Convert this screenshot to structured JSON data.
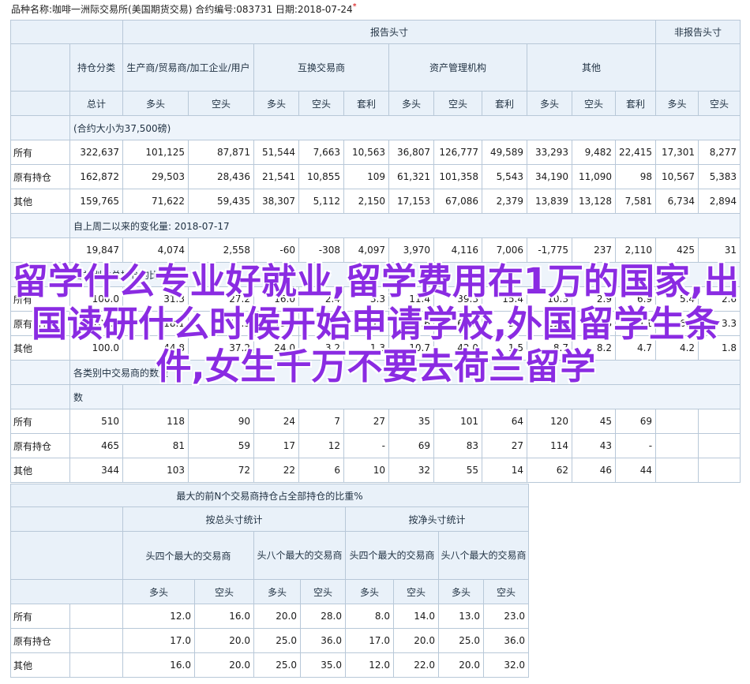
{
  "header": {
    "text": "品种名称:咖啡一洲际交易所(美国期货交易)   合约编号:083731   日期:2018-07-24",
    "mark": "*"
  },
  "table1": {
    "reportable": "报告头寸",
    "nonreportable": "非报告头寸",
    "holding_category": "持仓分类",
    "producers": "生产商/贸易商/加工企业/用户",
    "swap": "互换交易商",
    "managed": "资产管理机构",
    "other": "其他",
    "total": "总计",
    "long": "多头",
    "short": "空头",
    "spread": "套利",
    "note1": "(合约大小为37,500磅)",
    "note2": "自上周二以来的变化量: 2018-07-17",
    "note3": "各类别占总持仓的比例",
    "note4a": "各类别中交易商的数量",
    "note4b": "数",
    "rows_positions": [
      {
        "label": "所有",
        "values": [
          "322,637",
          "101,125",
          "87,871",
          "51,544",
          "7,663",
          "10,563",
          "36,807",
          "126,777",
          "49,589",
          "33,293",
          "9,482",
          "22,415",
          "17,301",
          "8,277"
        ]
      },
      {
        "label": "原有持仓",
        "values": [
          "162,872",
          "29,503",
          "28,436",
          "21,541",
          "10,855",
          "109",
          "61,321",
          "101,358",
          "5,543",
          "34,190",
          "11,090",
          "98",
          "10,567",
          "5,383"
        ]
      },
      {
        "label": "其他",
        "values": [
          "159,765",
          "71,622",
          "59,435",
          "38,307",
          "5,112",
          "2,150",
          "17,153",
          "67,086",
          "2,379",
          "13,839",
          "13,128",
          "7,581",
          "6,734",
          "2,894"
        ]
      }
    ],
    "row_changes": [
      "19,847",
      "4,074",
      "2,558",
      "-60",
      "-308",
      "4,097",
      "3,970",
      "4,116",
      "7,006",
      "-1,775",
      "237",
      "2,110",
      "425",
      "31"
    ],
    "rows_percent": [
      {
        "label": "所有",
        "values": [
          "100.0",
          "31.3",
          "27.2",
          "16.0",
          "2.4",
          "3.3",
          "11.4",
          "39.3",
          "15.4",
          "10.3",
          "2.9",
          "6.9",
          "5.4",
          "2.6"
        ]
      },
      {
        "label": "原有持仓",
        "values": [
          "100.0",
          "18.1",
          "17.5",
          "13.2",
          "6.7",
          "0.1",
          "37.6",
          "62.2",
          "3.4",
          "21.0",
          "6.8",
          "0.1",
          "6.5",
          "3.3"
        ]
      },
      {
        "label": "其他",
        "values": [
          "100.0",
          "44.8",
          "37.2",
          "24.0",
          "3.2",
          "1.3",
          "10.7",
          "42.0",
          "1.5",
          "8.7",
          "8.2",
          "4.7",
          "4.2",
          "1.8"
        ]
      }
    ],
    "rows_traders": [
      {
        "label": "所有",
        "values": [
          "510",
          "118",
          "90",
          "24",
          "7",
          "27",
          "35",
          "101",
          "64",
          "120",
          "45",
          "69",
          "",
          ""
        ]
      },
      {
        "label": "原有持仓",
        "values": [
          "465",
          "81",
          "59",
          "17",
          "12",
          "-",
          "69",
          "83",
          "27",
          "114",
          "43",
          "-",
          "",
          ""
        ]
      },
      {
        "label": "其他",
        "values": [
          "344",
          "103",
          "72",
          "22",
          "6",
          "10",
          "32",
          "55",
          "14",
          "62",
          "46",
          "44",
          "",
          ""
        ]
      }
    ]
  },
  "table2": {
    "title": "最大的前N个交易商持仓占全部持仓的比重%",
    "gross": "按总头寸统计",
    "net": "按净头寸统计",
    "top4": "头四个最大的交易商",
    "top8": "头八个最大的交易商",
    "long": "多头",
    "short": "空头",
    "rows": [
      {
        "label": "所有",
        "values": [
          "12.0",
          "16.0",
          "20.0",
          "28.0",
          "8.0",
          "14.0",
          "13.0",
          "23.0"
        ]
      },
      {
        "label": "原有持仓",
        "values": [
          "17.0",
          "20.0",
          "25.0",
          "36.0",
          "17.0",
          "20.0",
          "25.0",
          "36.0"
        ]
      },
      {
        "label": "其他",
        "values": [
          "16.0",
          "20.0",
          "25.0",
          "35.0",
          "12.0",
          "22.0",
          "20.0",
          "32.0"
        ]
      }
    ]
  },
  "overlay": {
    "text": "留学什么专业好就业,留学费用在1万的国家,出国读研什么时候开始申请学校,外国留学生条件,女生千万不要去荷兰留学"
  },
  "colors": {
    "header_bg": "#e9f1f9",
    "border": "#b8c8d8",
    "overlay_text": "#8a2be2"
  }
}
